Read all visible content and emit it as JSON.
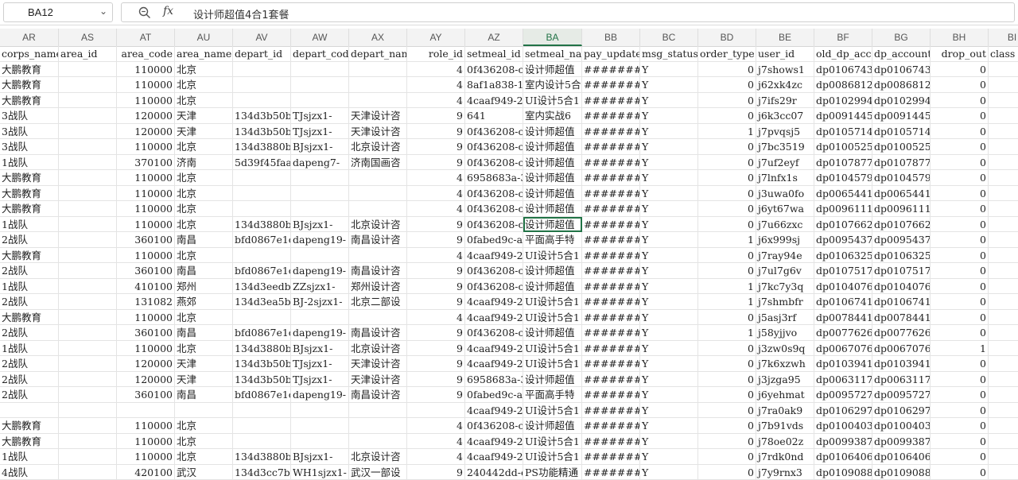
{
  "formula_bar": {
    "cell_ref": "BA12",
    "formula": "设计师超值4合1套餐"
  },
  "columns": [
    {
      "letter": "AR",
      "header": "corps_name"
    },
    {
      "letter": "AS",
      "header": "area_id"
    },
    {
      "letter": "AT",
      "header": "area_code"
    },
    {
      "letter": "AU",
      "header": "area_name"
    },
    {
      "letter": "AV",
      "header": "depart_id"
    },
    {
      "letter": "AW",
      "header": "depart_code"
    },
    {
      "letter": "AX",
      "header": "depart_name"
    },
    {
      "letter": "AY",
      "header": "role_id"
    },
    {
      "letter": "AZ",
      "header": "setmeal_id"
    },
    {
      "letter": "BA",
      "header": "setmeal_name"
    },
    {
      "letter": "BB",
      "header": "pay_updated"
    },
    {
      "letter": "BC",
      "header": "msg_status"
    },
    {
      "letter": "BD",
      "header": "order_type"
    },
    {
      "letter": "BE",
      "header": "user_id"
    },
    {
      "letter": "BF",
      "header": "old_dp_account"
    },
    {
      "letter": "BG",
      "header": "dp_account"
    },
    {
      "letter": "BH",
      "header": "drop_out"
    },
    {
      "letter": "BI",
      "header": "class"
    }
  ],
  "active_column": "BA",
  "selected_row_index": 10,
  "rows": [
    [
      "大鹏教育",
      "",
      "110000",
      "北京",
      "",
      "",
      "",
      "4",
      "0f436208-c",
      "设计师超值",
      "#########",
      "Y",
      "0",
      "j7shows1",
      "dp0106743€",
      "dp0106743€",
      "0",
      ""
    ],
    [
      "大鹏教育",
      "",
      "110000",
      "北京",
      "",
      "",
      "",
      "4",
      "8af1a838-1",
      "室内设计5合",
      "#########",
      "Y",
      "0",
      "j62xk4zc",
      "dp0086812(",
      "dp0086812(",
      "0",
      ""
    ],
    [
      "大鹏教育",
      "",
      "110000",
      "北京",
      "",
      "",
      "",
      "4",
      "4caaf949-2",
      "UI设计5合1",
      "#########",
      "Y",
      "0",
      "j7ifs29r",
      "dp0102994(",
      "dp0102994(",
      "0",
      ""
    ],
    [
      "3战队",
      "",
      "120000",
      "天津",
      "134d3b50b8",
      "TJsjzx1-",
      "天津设计咨",
      "9",
      "641",
      "室内实战6",
      "#########",
      "Y",
      "0",
      "j6k3cc07",
      "dp0091445",
      "dp0091445",
      "0",
      ""
    ],
    [
      "3战队",
      "",
      "120000",
      "天津",
      "134d3b50b8",
      "TJsjzx1-",
      "天津设计咨",
      "9",
      "0f436208-c",
      "设计师超值",
      "#########",
      "Y",
      "1",
      "j7pvqsj5",
      "dp0105714",
      "dp0105714",
      "0",
      ""
    ],
    [
      "3战队",
      "",
      "110000",
      "北京",
      "134d3880b8",
      "BJsjzx1-",
      "北京设计咨",
      "9",
      "0f436208-c",
      "设计师超值",
      "#########",
      "Y",
      "0",
      "j7bc3519",
      "dp0100525",
      "dp0100525",
      "0",
      ""
    ],
    [
      "1战队",
      "",
      "370100",
      "济南",
      "5d39f45faa",
      "dapeng7-",
      "济南国画咨",
      "9",
      "0f436208-c",
      "设计师超值",
      "#########",
      "Y",
      "0",
      "j7uf2eyf",
      "dp0107877",
      "dp0107877",
      "0",
      ""
    ],
    [
      "大鹏教育",
      "",
      "110000",
      "北京",
      "",
      "",
      "",
      "4",
      "6958683a-3",
      "设计师超值",
      "#########",
      "Y",
      "0",
      "j7lnfx1s",
      "dp0104579€",
      "dp0104579€",
      "0",
      ""
    ],
    [
      "大鹏教育",
      "",
      "110000",
      "北京",
      "",
      "",
      "",
      "4",
      "0f436208-c",
      "设计师超值",
      "#########",
      "Y",
      "0",
      "j3uwa0fo",
      "dp0065441",
      "dp0065441",
      "0",
      ""
    ],
    [
      "大鹏教育",
      "",
      "110000",
      "北京",
      "",
      "",
      "",
      "4",
      "0f436208-c",
      "设计师超值",
      "#########",
      "Y",
      "0",
      "j6yt67wa",
      "dp0096111",
      "dp0096111",
      "0",
      ""
    ],
    [
      "1战队",
      "",
      "110000",
      "北京",
      "134d3880b8",
      "BJsjzx1-",
      "北京设计咨",
      "9",
      "0f436208-c",
      "设计师超值",
      "#########",
      "Y",
      "0",
      "j7u66zxc",
      "dp0107662",
      "dp0107662",
      "0",
      ""
    ],
    [
      "2战队",
      "",
      "360100",
      "南昌",
      "bfd0867e1c",
      "dapeng19-",
      "南昌设计咨",
      "9",
      "0fabed9c-a",
      "平面高手特",
      "#########",
      "Y",
      "1",
      "j6x999sj",
      "dp0095437",
      "dp0095437",
      "0",
      ""
    ],
    [
      "大鹏教育",
      "",
      "110000",
      "北京",
      "",
      "",
      "",
      "4",
      "4caaf949-2",
      "UI设计5合1",
      "#########",
      "Y",
      "0",
      "j7ray94e",
      "dp0106325€",
      "dp0106325€",
      "0",
      ""
    ],
    [
      "2战队",
      "",
      "360100",
      "南昌",
      "bfd0867e1c",
      "dapeng19-",
      "南昌设计咨",
      "9",
      "0f436208-c",
      "设计师超值",
      "#########",
      "Y",
      "0",
      "j7ul7g6v",
      "dp0107517",
      "dp0107517",
      "0",
      ""
    ],
    [
      "1战队",
      "",
      "410100",
      "郑州",
      "134d3eedbc",
      "ZZsjzx1-",
      "郑州设计咨",
      "9",
      "0f436208-c",
      "设计师超值",
      "#########",
      "Y",
      "1",
      "j7kc7y3q",
      "dp0104076",
      "dp0104076",
      "0",
      ""
    ],
    [
      "2战队",
      "",
      "131082",
      "燕郊",
      "134d3ea5b8",
      "BJ-2sjzx1-",
      "北京二部设",
      "9",
      "4caaf949-2",
      "UI设计5合1",
      "#########",
      "Y",
      "1",
      "j7shmbfr",
      "dp0106741(",
      "dp0106741(",
      "0",
      ""
    ],
    [
      "大鹏教育",
      "",
      "110000",
      "北京",
      "",
      "",
      "",
      "4",
      "4caaf949-2",
      "UI设计5合1",
      "#########",
      "Y",
      "0",
      "j5asj3rf",
      "dp0078441",
      "dp0078441",
      "0",
      ""
    ],
    [
      "2战队",
      "",
      "360100",
      "南昌",
      "bfd0867e1c",
      "dapeng19-",
      "南昌设计咨",
      "9",
      "0f436208-c",
      "设计师超值",
      "#########",
      "Y",
      "1",
      "j58yjjvo",
      "dp0077626",
      "dp0077626",
      "0",
      ""
    ],
    [
      "1战队",
      "",
      "110000",
      "北京",
      "134d3880b8",
      "BJsjzx1-",
      "北京设计咨",
      "9",
      "4caaf949-2",
      "UI设计5合1",
      "#########",
      "Y",
      "0",
      "j3zw0s9q",
      "dp0067076",
      "dp0067076",
      "1",
      ""
    ],
    [
      "2战队",
      "",
      "120000",
      "天津",
      "134d3b50b8",
      "TJsjzx1-",
      "天津设计咨",
      "9",
      "4caaf949-2",
      "UI设计5合1",
      "#########",
      "Y",
      "0",
      "j7k6xzwh",
      "dp0103941",
      "dp0103941",
      "0",
      ""
    ],
    [
      "2战队",
      "",
      "120000",
      "天津",
      "134d3b50b8",
      "TJsjzx1-",
      "天津设计咨",
      "9",
      "6958683a-3",
      "设计师超值",
      "#########",
      "Y",
      "0",
      "j3jzga95",
      "dp0063117(",
      "dp0063117(",
      "0",
      ""
    ],
    [
      "2战队",
      "",
      "360100",
      "南昌",
      "bfd0867e1c",
      "dapeng19-",
      "南昌设计咨",
      "9",
      "0fabed9c-a",
      "平面高手特",
      "#########",
      "Y",
      "0",
      "j6yehmat",
      "dp0095727€",
      "dp0095727€",
      "0",
      ""
    ],
    [
      "",
      "",
      "",
      "",
      "",
      "",
      "",
      "",
      "4caaf949-2",
      "UI设计5合1",
      "#########",
      "Y",
      "0",
      "j7ra0ak9",
      "dp0106297",
      "dp0106297",
      "0",
      ""
    ],
    [
      "大鹏教育",
      "",
      "110000",
      "北京",
      "",
      "",
      "",
      "4",
      "0f436208-c",
      "设计师超值",
      "#########",
      "Y",
      "0",
      "j7b91vds",
      "dp0100403",
      "dp0100403",
      "0",
      ""
    ],
    [
      "大鹏教育",
      "",
      "110000",
      "北京",
      "",
      "",
      "",
      "4",
      "4caaf949-2",
      "UI设计5合1",
      "#########",
      "Y",
      "0",
      "j78oe02z",
      "dp0099387",
      "dp0099387",
      "0",
      ""
    ],
    [
      "1战队",
      "",
      "110000",
      "北京",
      "134d3880b8",
      "BJsjzx1-",
      "北京设计咨",
      "4",
      "4caaf949-2",
      "UI设计5合1",
      "#########",
      "Y",
      "0",
      "j7rdk0nd",
      "dp0106406",
      "dp0106406",
      "0",
      ""
    ],
    [
      "4战队",
      "",
      "420100",
      "武汉",
      "134d3cc7b8",
      "WH1sjzx1-",
      "武汉一部设",
      "9",
      "240442dd-e",
      "PS功能精通",
      "#########",
      "Y",
      "0",
      "j7y9rnx3",
      "dp0109088",
      "dp0109088",
      "0",
      ""
    ]
  ]
}
